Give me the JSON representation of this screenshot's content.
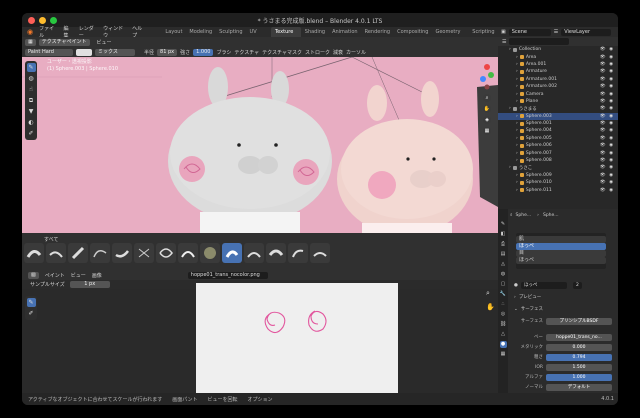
{
  "window": {
    "title": "* うさまる完成版.blend – Blender 4.0.1 LTS"
  },
  "menu": {
    "items": [
      "ファイル",
      "編集",
      "レンダー",
      "ウィンドウ",
      "ヘルプ"
    ]
  },
  "workspaces": {
    "tabs": [
      "Layout",
      "Modeling",
      "Sculpting",
      "UV Editing",
      "Texture Paint",
      "Shading",
      "Animation",
      "Rendering",
      "Compositing",
      "Geometry Nodes",
      "Scripting"
    ],
    "active": "Texture Paint"
  },
  "scene": {
    "label": "Scene",
    "view_layer": "ViewLayer"
  },
  "tool_header": {
    "mode": "テクスチャペイント",
    "view": "ビュー",
    "image": "hoppe01_trans_nocolor.png"
  },
  "tool_header2": {
    "brush": "Paint Hard",
    "blend": "ミックス",
    "radius_label": "半径",
    "radius_value": "81 px",
    "strength_label": "強さ",
    "strength_value": "1.000",
    "brush_menu": "ブラシ",
    "texture": "テクスチャ",
    "texture_mask": "テクスチャマスク",
    "stroke": "ストローク",
    "falloff": "減衰",
    "cursor": "カーソル"
  },
  "viewport": {
    "info_line1": "ユーザー・透視投影",
    "info_line2": "(1) Sphere.003 | Sphere.010"
  },
  "brush_panel": {
    "tab_label": "すべて"
  },
  "image_editor": {
    "mode": "ペイント",
    "view": "ビュー",
    "image_menu": "画像",
    "image_name": "hoppe01_trans_nocolor.png",
    "sample_label": "サンプルサイズ",
    "sample_value": "1 px"
  },
  "status": {
    "item1": "アクティブなオブジェクトに合わせてスケールが行われます",
    "item2": "画面パント",
    "item3": "ビューを回転",
    "item4": "オプション",
    "version": "4.0.1"
  },
  "outliner": {
    "rows": [
      {
        "name": "Collection",
        "indent": 1,
        "color": "#9a9a9a"
      },
      {
        "name": "Area",
        "indent": 2,
        "color": "#e0a23a"
      },
      {
        "name": "Area.001",
        "indent": 2,
        "color": "#e0a23a"
      },
      {
        "name": "Armature",
        "indent": 2,
        "color": "#e0a23a"
      },
      {
        "name": "Armature.001",
        "indent": 2,
        "color": "#e0a23a"
      },
      {
        "name": "Armature.002",
        "indent": 2,
        "color": "#e0a23a"
      },
      {
        "name": "Camera",
        "indent": 2,
        "color": "#e0a23a"
      },
      {
        "name": "Plane",
        "indent": 2,
        "color": "#e0a23a"
      },
      {
        "name": "うさまる",
        "indent": 1,
        "color": "#9a9a9a"
      },
      {
        "name": "Sphere.003",
        "indent": 2,
        "color": "#e0a23a",
        "selected": true
      },
      {
        "name": "Sphere.001",
        "indent": 2,
        "color": "#e0a23a"
      },
      {
        "name": "Sphere.004",
        "indent": 2,
        "color": "#e0a23a"
      },
      {
        "name": "Sphere.005",
        "indent": 2,
        "color": "#e0a23a"
      },
      {
        "name": "Sphere.006",
        "indent": 2,
        "color": "#e0a23a"
      },
      {
        "name": "Sphere.007",
        "indent": 2,
        "color": "#e0a23a"
      },
      {
        "name": "Sphere.008",
        "indent": 2,
        "color": "#e0a23a"
      },
      {
        "name": "うさこ",
        "indent": 1,
        "color": "#9a9a9a"
      },
      {
        "name": "Sphere.009",
        "indent": 2,
        "color": "#e0a23a"
      },
      {
        "name": "Sphere.010",
        "indent": 2,
        "color": "#e0a23a"
      },
      {
        "name": "Sphere.011",
        "indent": 2,
        "color": "#e0a23a"
      }
    ]
  },
  "properties": {
    "breadcrumb1": "Sphe...",
    "breadcrumb2": "Sphe...",
    "slots": [
      "肌",
      "ほっぺ",
      "目",
      "ほっぺ"
    ],
    "selected_slot": 1,
    "material_name": "ほっぺ",
    "users": "2",
    "preview_label": "プレビュー",
    "surface_section": "サーフェス",
    "surface_label": "サーフェス",
    "surface_value": "プリンシプルBSDF",
    "base_label": "ベー",
    "base_value": "hoppe01_trans_no...",
    "metallic_label": "メタリック",
    "metallic_value": "0.000",
    "roughness_label": "粗さ",
    "roughness_value": "0.794",
    "ior_label": "IOR",
    "ior_value": "1.500",
    "alpha_label": "アルファ",
    "alpha_value": "1.000",
    "normal_label": "ノーマル",
    "normal_value": "デフォルト"
  }
}
